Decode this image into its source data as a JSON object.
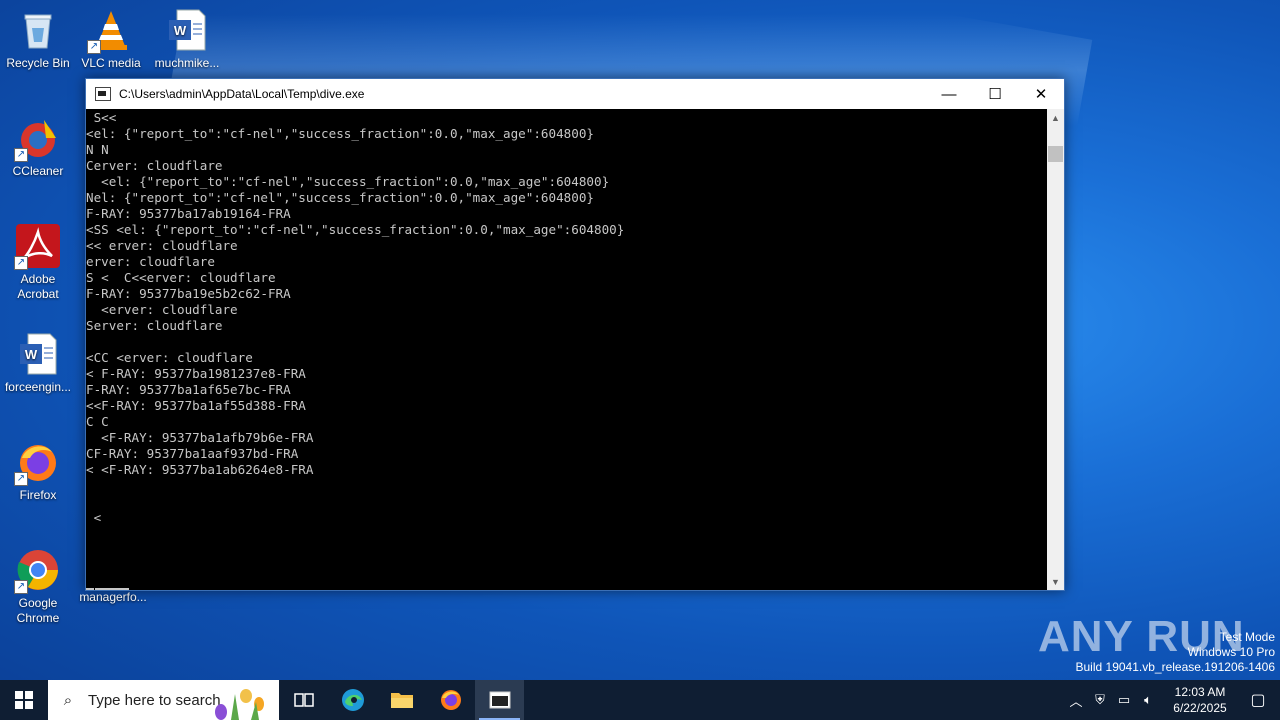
{
  "desktop": {
    "icons": [
      {
        "name": "recycle-bin",
        "label": "Recycle Bin"
      },
      {
        "name": "vlc",
        "label": "VLC media"
      },
      {
        "name": "word-doc-1",
        "label": "muchmike..."
      },
      {
        "name": "ccleaner",
        "label": "CCleaner"
      },
      {
        "name": "adobe-acrobat",
        "label": "Adobe Acrobat"
      },
      {
        "name": "word-doc-2",
        "label": "forceengin..."
      },
      {
        "name": "firefox",
        "label": "Firefox"
      },
      {
        "name": "google-chrome",
        "label": "Google Chrome"
      },
      {
        "name": "managerfo",
        "label": "managerfo..."
      }
    ]
  },
  "console": {
    "title": "C:\\Users\\admin\\AppData\\Local\\Temp\\dive.exe",
    "lines": [
      " S<<",
      "<el: {\"report_to\":\"cf-nel\",\"success_fraction\":0.0,\"max_age\":604800}",
      "N N",
      "Cerver: cloudflare",
      "  <el: {\"report_to\":\"cf-nel\",\"success_fraction\":0.0,\"max_age\":604800}",
      "Nel: {\"report_to\":\"cf-nel\",\"success_fraction\":0.0,\"max_age\":604800}",
      "F-RAY: 95377ba17ab19164-FRA",
      "<SS <el: {\"report_to\":\"cf-nel\",\"success_fraction\":0.0,\"max_age\":604800}",
      "<< erver: cloudflare",
      "erver: cloudflare",
      "S <  C<<erver: cloudflare",
      "F-RAY: 95377ba19e5b2c62-FRA",
      "  <erver: cloudflare",
      "Server: cloudflare",
      "",
      "<CC <erver: cloudflare",
      "< F-RAY: 95377ba1981237e8-FRA",
      "F-RAY: 95377ba1af65e7bc-FRA",
      "<<F-RAY: 95377ba1af55d388-FRA",
      "C C",
      "  <F-RAY: 95377ba1afb79b6e-FRA",
      "CF-RAY: 95377ba1aaf937bd-FRA",
      "< <F-RAY: 95377ba1ab6264e8-FRA",
      "",
      "",
      " <"
    ],
    "buttons": {
      "minimize": "—",
      "maximize": "☐",
      "close": "✕"
    }
  },
  "taskbar": {
    "search_placeholder": "Type here to search",
    "time": "12:03 AM",
    "date": "6/22/2025"
  },
  "watermark": {
    "line1": "Test Mode",
    "line2": "Windows 10 Pro",
    "line3": "Build 19041.vb_release.191206-1406",
    "brand": "ANY RUN"
  }
}
